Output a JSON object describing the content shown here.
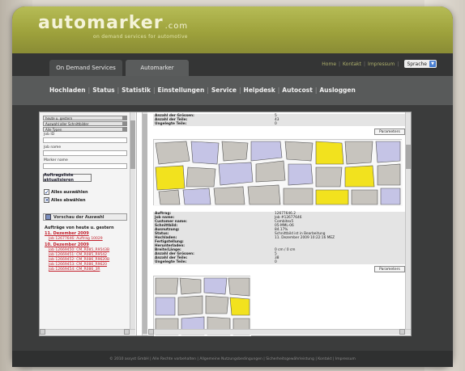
{
  "brand": {
    "name": "automarker",
    "suffix": ".com",
    "tagline": "on demand services for automotive"
  },
  "tabs": [
    {
      "label": "On Demand Services"
    },
    {
      "label": "Automarker"
    }
  ],
  "toplinks": {
    "home": "Home",
    "kontakt": "Kontakt",
    "impressum": "Impressum",
    "sep": "|"
  },
  "language": {
    "label": "Sprache"
  },
  "nav": {
    "sep": "|",
    "items": [
      "Hochladen",
      "Status",
      "Statistik",
      "Einstellungen",
      "Service",
      "Helpdesk",
      "Autocost",
      "Ausloggen"
    ]
  },
  "filters": {
    "select1": "heute u. gestern",
    "select2": "Auswahl aller Schnittbilder",
    "select3": "Alle Typen",
    "field1_label": "Job ID",
    "field2_label": "Job name",
    "field3_label": "Marker name"
  },
  "buttons": {
    "update_orders": "Auftragsliste aktualisieren",
    "select_all": "Alles auswählen",
    "deselect_all": "Alles abwählen",
    "preview": "Vorschau der Auswahl",
    "parameters": "Parameters"
  },
  "orders": {
    "title": "Aufträge von heute u. gestern",
    "dates": [
      "11. Dezember 2009",
      "10. Dezember 2009"
    ],
    "jobs_today": [
      "Job 12677646: Auftrag 10029"
    ],
    "jobs_yesterday": [
      "Job 12669450: CM_R085_R9543B",
      "Job 12669451: CM_R085_R9542",
      "Job 12669452: CM_R086_R9620B",
      "Job 12669453: CM_R086_R9620",
      "Job 12669454: CM_R086_3R"
    ]
  },
  "summary1": {
    "rows": [
      {
        "k": "Anzahl der Grössen:",
        "v": "5"
      },
      {
        "k": "Anzahl der Teile:",
        "v": "43"
      },
      {
        "k": "Ungelegte Teile:",
        "v": "0"
      }
    ]
  },
  "details": {
    "rows": [
      {
        "k": "Auftrag:",
        "v": "12677646.2"
      },
      {
        "k": "Job name:",
        "v": "Job #12677646"
      },
      {
        "k": "Customer name:",
        "v": "Combitex5"
      },
      {
        "k": "Schnittbild:",
        "v": "05-MML-06"
      },
      {
        "k": "Ausnutzung:",
        "v": "84.17%"
      },
      {
        "k": "Status:",
        "v": "Schnittbild ist in Bearbeitung"
      },
      {
        "k": "Hochladen:",
        "v": "11. Dezember 2009 10:22:16 MEZ"
      },
      {
        "k": "Fertigstellung:",
        "v": ""
      },
      {
        "k": "Herunterladen:",
        "v": ""
      },
      {
        "k": "Breite/Länge:",
        "v": "0 cm / 0 cm"
      },
      {
        "k": "Anzahl der Grössen:",
        "v": "5"
      },
      {
        "k": "Anzahl der Teile:",
        "v": "38"
      },
      {
        "k": "Ungelegte Teile:",
        "v": "0"
      }
    ]
  },
  "colors": {
    "header_green": "#a3a842",
    "link_red": "#c21f2b",
    "piece_yellow": "#f2e21e",
    "piece_lavender": "#c5c4e6",
    "piece_gray": "#c7c4be"
  },
  "footer": {
    "text": "© 2010 assyst GmbH | Alle Rechte vorbehalten | Allgemeine Nutzungsbedingungen | Sicherheitsgewährleistung | Kontakt | Impressum"
  }
}
